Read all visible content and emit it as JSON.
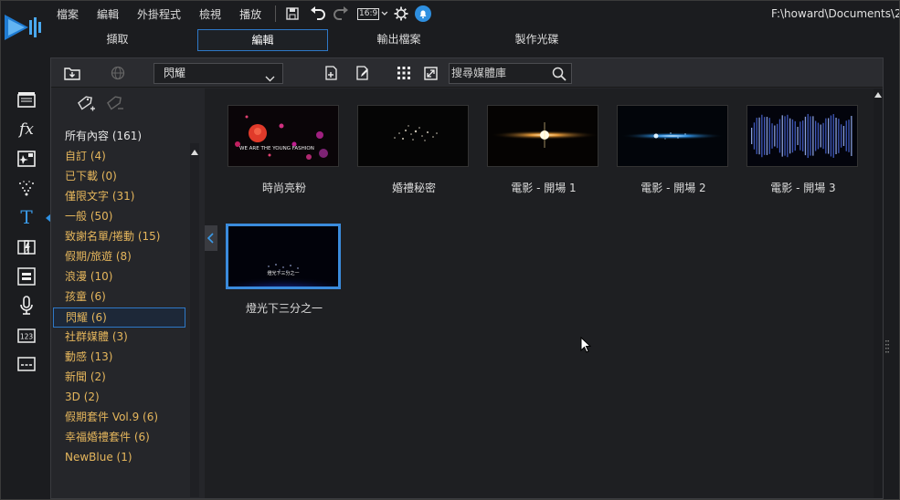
{
  "menu": {
    "items": [
      "檔案",
      "編輯",
      "外掛程式",
      "檢視",
      "播放"
    ],
    "aspect_ratio": "16:9",
    "path": "F:\\howard\\Documents\\2"
  },
  "modes": {
    "tabs": [
      "擷取",
      "編輯",
      "輸出檔案",
      "製作光碟"
    ],
    "active": "編輯"
  },
  "toolbar": {
    "category_dropdown": "閃耀",
    "search_placeholder": "搜尋媒體庫"
  },
  "categories": [
    {
      "label": "所有內容 (161)"
    },
    {
      "label": "自訂  (4)"
    },
    {
      "label": "已下載  (0)"
    },
    {
      "label": "僅限文字  (31)"
    },
    {
      "label": "一般  (50)"
    },
    {
      "label": "致謝名單/捲動  (15)"
    },
    {
      "label": "假期/旅遊  (8)"
    },
    {
      "label": "浪漫  (10)"
    },
    {
      "label": "孩童  (6)"
    },
    {
      "label": "閃耀  (6)"
    },
    {
      "label": "社群媒體  (3)"
    },
    {
      "label": "動感  (13)"
    },
    {
      "label": "新聞  (2)"
    },
    {
      "label": "3D  (2)"
    },
    {
      "label": "假期套件 Vol.9  (6)"
    },
    {
      "label": "幸福婚禮套件  (6)"
    },
    {
      "label": "NewBlue  (1)"
    }
  ],
  "selected_category": "閃耀  (6)",
  "thumb_overlay_text": {
    "item1": "WE ARE THE YOUNG FASHION",
    "item6": "燈光下三分之一"
  },
  "items": [
    {
      "title": "時尚亮粉"
    },
    {
      "title": "婚禮秘密"
    },
    {
      "title": "電影 - 開場 1"
    },
    {
      "title": "電影 - 開場 2"
    },
    {
      "title": "電影 - 開場 3"
    },
    {
      "title": "燈光下三分之一"
    }
  ],
  "colors": {
    "accent": "#2e78c7",
    "category_text": "#e5b65c",
    "background": "#1e1f22"
  }
}
